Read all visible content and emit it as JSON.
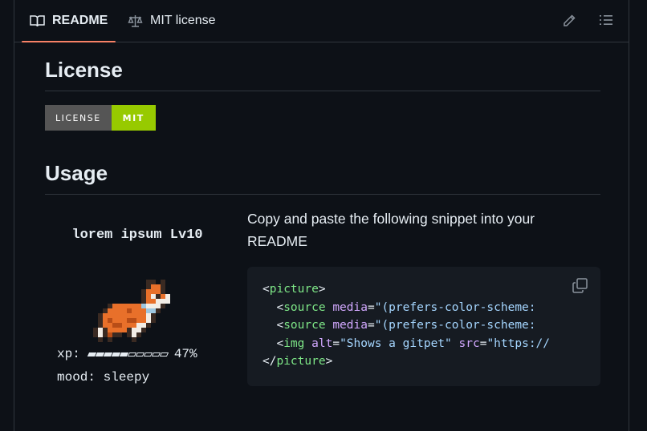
{
  "tabs": [
    {
      "label": "README",
      "icon": "book-icon",
      "active": true
    },
    {
      "label": "MIT license",
      "icon": "law-icon",
      "active": false
    }
  ],
  "toolbar": {
    "edit_icon": "pencil-icon",
    "outline_icon": "list-icon"
  },
  "license": {
    "heading": "License",
    "badge_label": "LICENSE",
    "badge_value": "MIT",
    "badge_color": "#97ca00"
  },
  "usage": {
    "heading": "Usage",
    "instructions": "Copy and paste the following snippet into your README"
  },
  "pet": {
    "title": "lorem ipsum Lv10",
    "xp_label": "xp:",
    "xp_percent": "47%",
    "xp_fraction": 0.47,
    "mood_label": "mood: sleepy"
  },
  "snippet": {
    "lines": [
      "<picture>",
      "  <source media=\"(prefers-color-scheme:",
      "  <source media=\"(prefers-color-scheme:",
      "  <img alt=\"Shows a gitpet\" src=\"https://",
      "</picture>"
    ],
    "copy_icon": "copy-icon"
  },
  "colors": {
    "accent": "#f78166",
    "background": "#0d1117",
    "code_bg": "#161b22"
  }
}
